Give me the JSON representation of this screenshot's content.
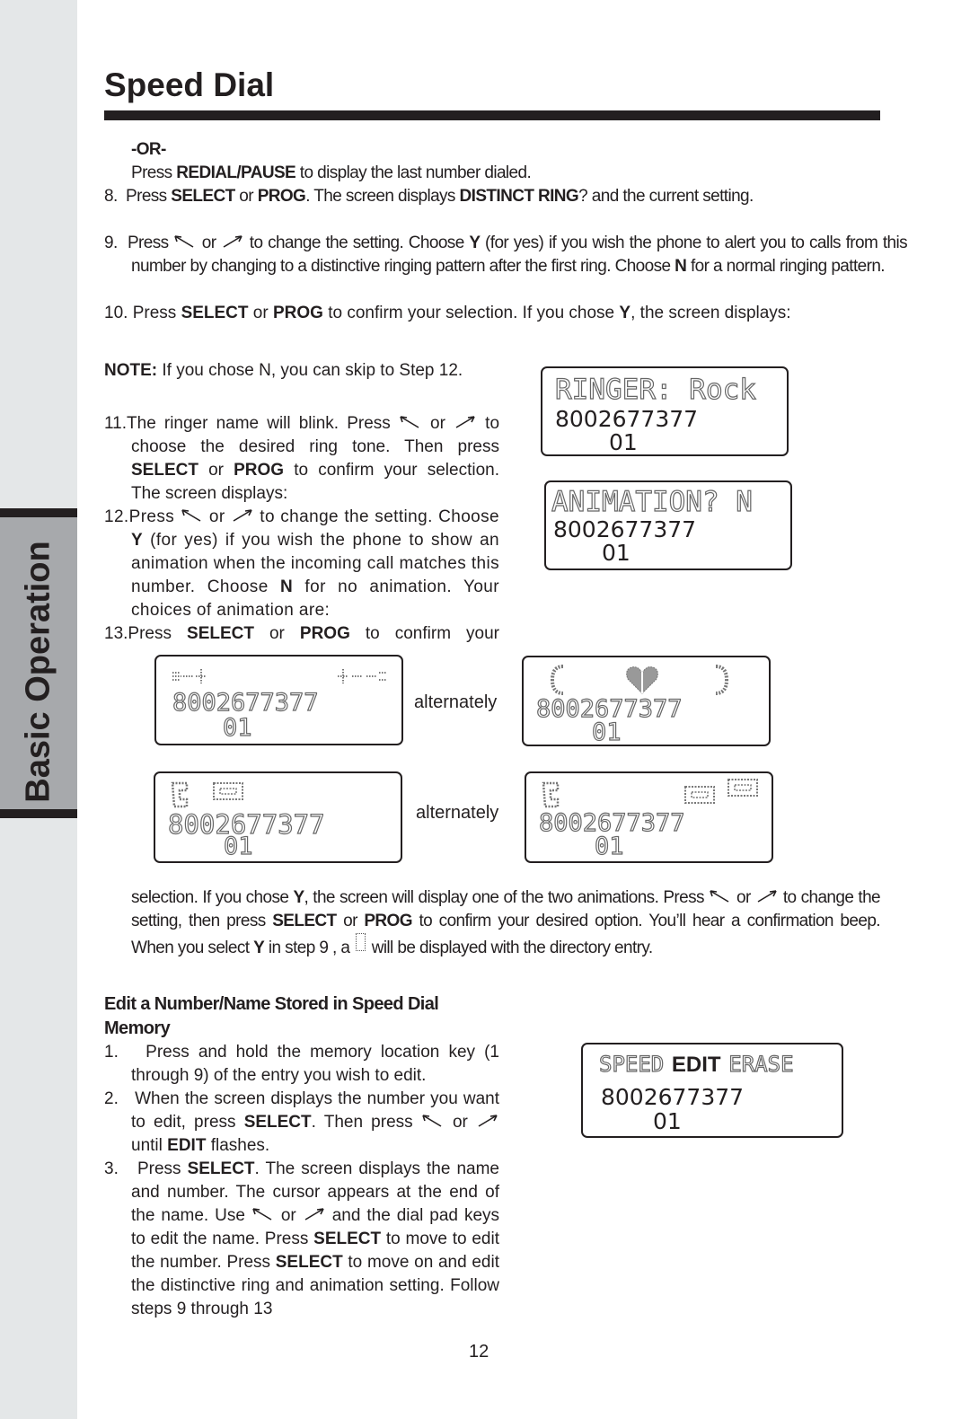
{
  "sidebar": {
    "tab_label": "Basic Operation"
  },
  "header": {
    "title": "Speed Dial"
  },
  "colors": {
    "text": "#231f20",
    "sidebar_strip": "#e4e7e8",
    "side_tab": "#a7a9ac",
    "lcd_dot": "#666666"
  },
  "intro": {
    "or_label": "-OR-",
    "redial": {
      "pre": "Press ",
      "key": "REDIAL/PAUSE",
      "post": " to display the last number dialed."
    }
  },
  "steps_top": [
    {
      "num": "8.",
      "parts": [
        "Press ",
        "SELECT",
        " or ",
        "PROG",
        ". The screen displays ",
        "DISTINCT RING",
        "? and the current setting."
      ]
    },
    {
      "num": "9.",
      "parts": [
        "Press ",
        "{down}",
        " or ",
        "{up}",
        " to change the setting. Choose ",
        "Y",
        " (for yes) if you wish the phone to alert you to calls from this number by changing to a distinctive ringing pattern after the first ring. Choose ",
        "N",
        " for a normal ringing pattern."
      ]
    },
    {
      "num": "10.",
      "parts": [
        "Press ",
        "SELECT",
        " or ",
        "PROG",
        " to confirm your selection.  If you chose ",
        "Y",
        ", the screen displays:"
      ]
    }
  ],
  "note": {
    "label": "NOTE:",
    "text": " If you chose N, you can skip to Step 12."
  },
  "step11": {
    "num": "11.",
    "pre": "The ringer name will blink.  Press ",
    "or": " or ",
    "mid": " to choose the desired ring tone. Then press ",
    "k1": "SELECT",
    "or2": " or ",
    "k2": "PROG",
    "post": " to confirm your selection. The screen displays:"
  },
  "step12": {
    "num": "12.",
    "pre": "Press ",
    "or": " or ",
    "mid": " to change the setting. Choose ",
    "y": "Y",
    "mid2": " (for yes) if you wish the phone to show an animation when the incoming call matches this number.  Choose ",
    "n": "N",
    "post": " for no animation. Your choices of animation are:"
  },
  "step13": {
    "num": "13.",
    "pre": "Press ",
    "k1": "SELECT",
    "or": " or ",
    "k2": "PROG",
    "post": " to confirm your"
  },
  "lcd_ringer": {
    "line1": "RINGER: Rock",
    "number": "8002677377",
    "index": "01"
  },
  "lcd_animation": {
    "line1": "ANIMATION? N",
    "number": "8002677377",
    "index": "01"
  },
  "animations": {
    "alternately_label": "alternately",
    "row1": {
      "left": {
        "glyph_left": "airplane-left",
        "glyph_right": "airplane-right",
        "number": "8002677377",
        "index": "01"
      },
      "right": {
        "glyph_left": "(",
        "glyph_center": "heart",
        "glyph_right": ")",
        "number": "8002677377",
        "index": "01"
      }
    },
    "row2": {
      "left": {
        "glyph_left": "phone-handset",
        "glyph_right": "envelope",
        "number": "8002677377",
        "index": "01"
      },
      "right": {
        "glyph_left": "phone-handset",
        "glyph_right": "envelopes",
        "number": "8002677377",
        "index": "01"
      }
    }
  },
  "step13_cont": {
    "a": "selection. If you chose ",
    "y": "Y",
    "b": ", the screen will display one of the two animations.  Press ",
    "or": " or ",
    "c": " to change the setting,  then press ",
    "k1": "SELECT",
    "or2": " or ",
    "k2": "PROG",
    "d": " to confirm your desired option. You’ll hear a confirmation beep. When you select ",
    "y2": "Y",
    "e": " in step 9 , a ",
    "f": " will be displayed with the directory entry."
  },
  "edit_section": {
    "heading": "Edit a Number/Name Stored in Speed Dial Memory",
    "step1": {
      "num": "1.",
      "text": "Press and hold the memory location key (1 through 9) of the entry you wish to edit."
    },
    "step2": {
      "num": "2.",
      "pre": "When the screen displays the number you want to edit, press ",
      "k1": "SELECT",
      "mid": ".  Then press ",
      "or": " or ",
      "k2": "EDIT",
      "post": " flashes.",
      "until": " until "
    },
    "step3": {
      "num": "3.",
      "pre": "Press ",
      "k1": "SELECT",
      "a": ". The screen displays the name and number. The cursor appears at the end of the name. Use ",
      "or": " or ",
      "b": " and the dial pad keys to edit the name. Press ",
      "k2": "SELECT",
      "c": " to move to edit the number. Press ",
      "k3": "SELECT",
      "d": " to move on and edit the distinctive ring and animation setting. Follow steps 9 through 13"
    }
  },
  "lcd_edit": {
    "opt1": "SPEED",
    "opt2": "EDIT",
    "opt3": "ERASE",
    "number": "8002677377",
    "index": "01"
  },
  "footer": {
    "page_number": "12"
  }
}
